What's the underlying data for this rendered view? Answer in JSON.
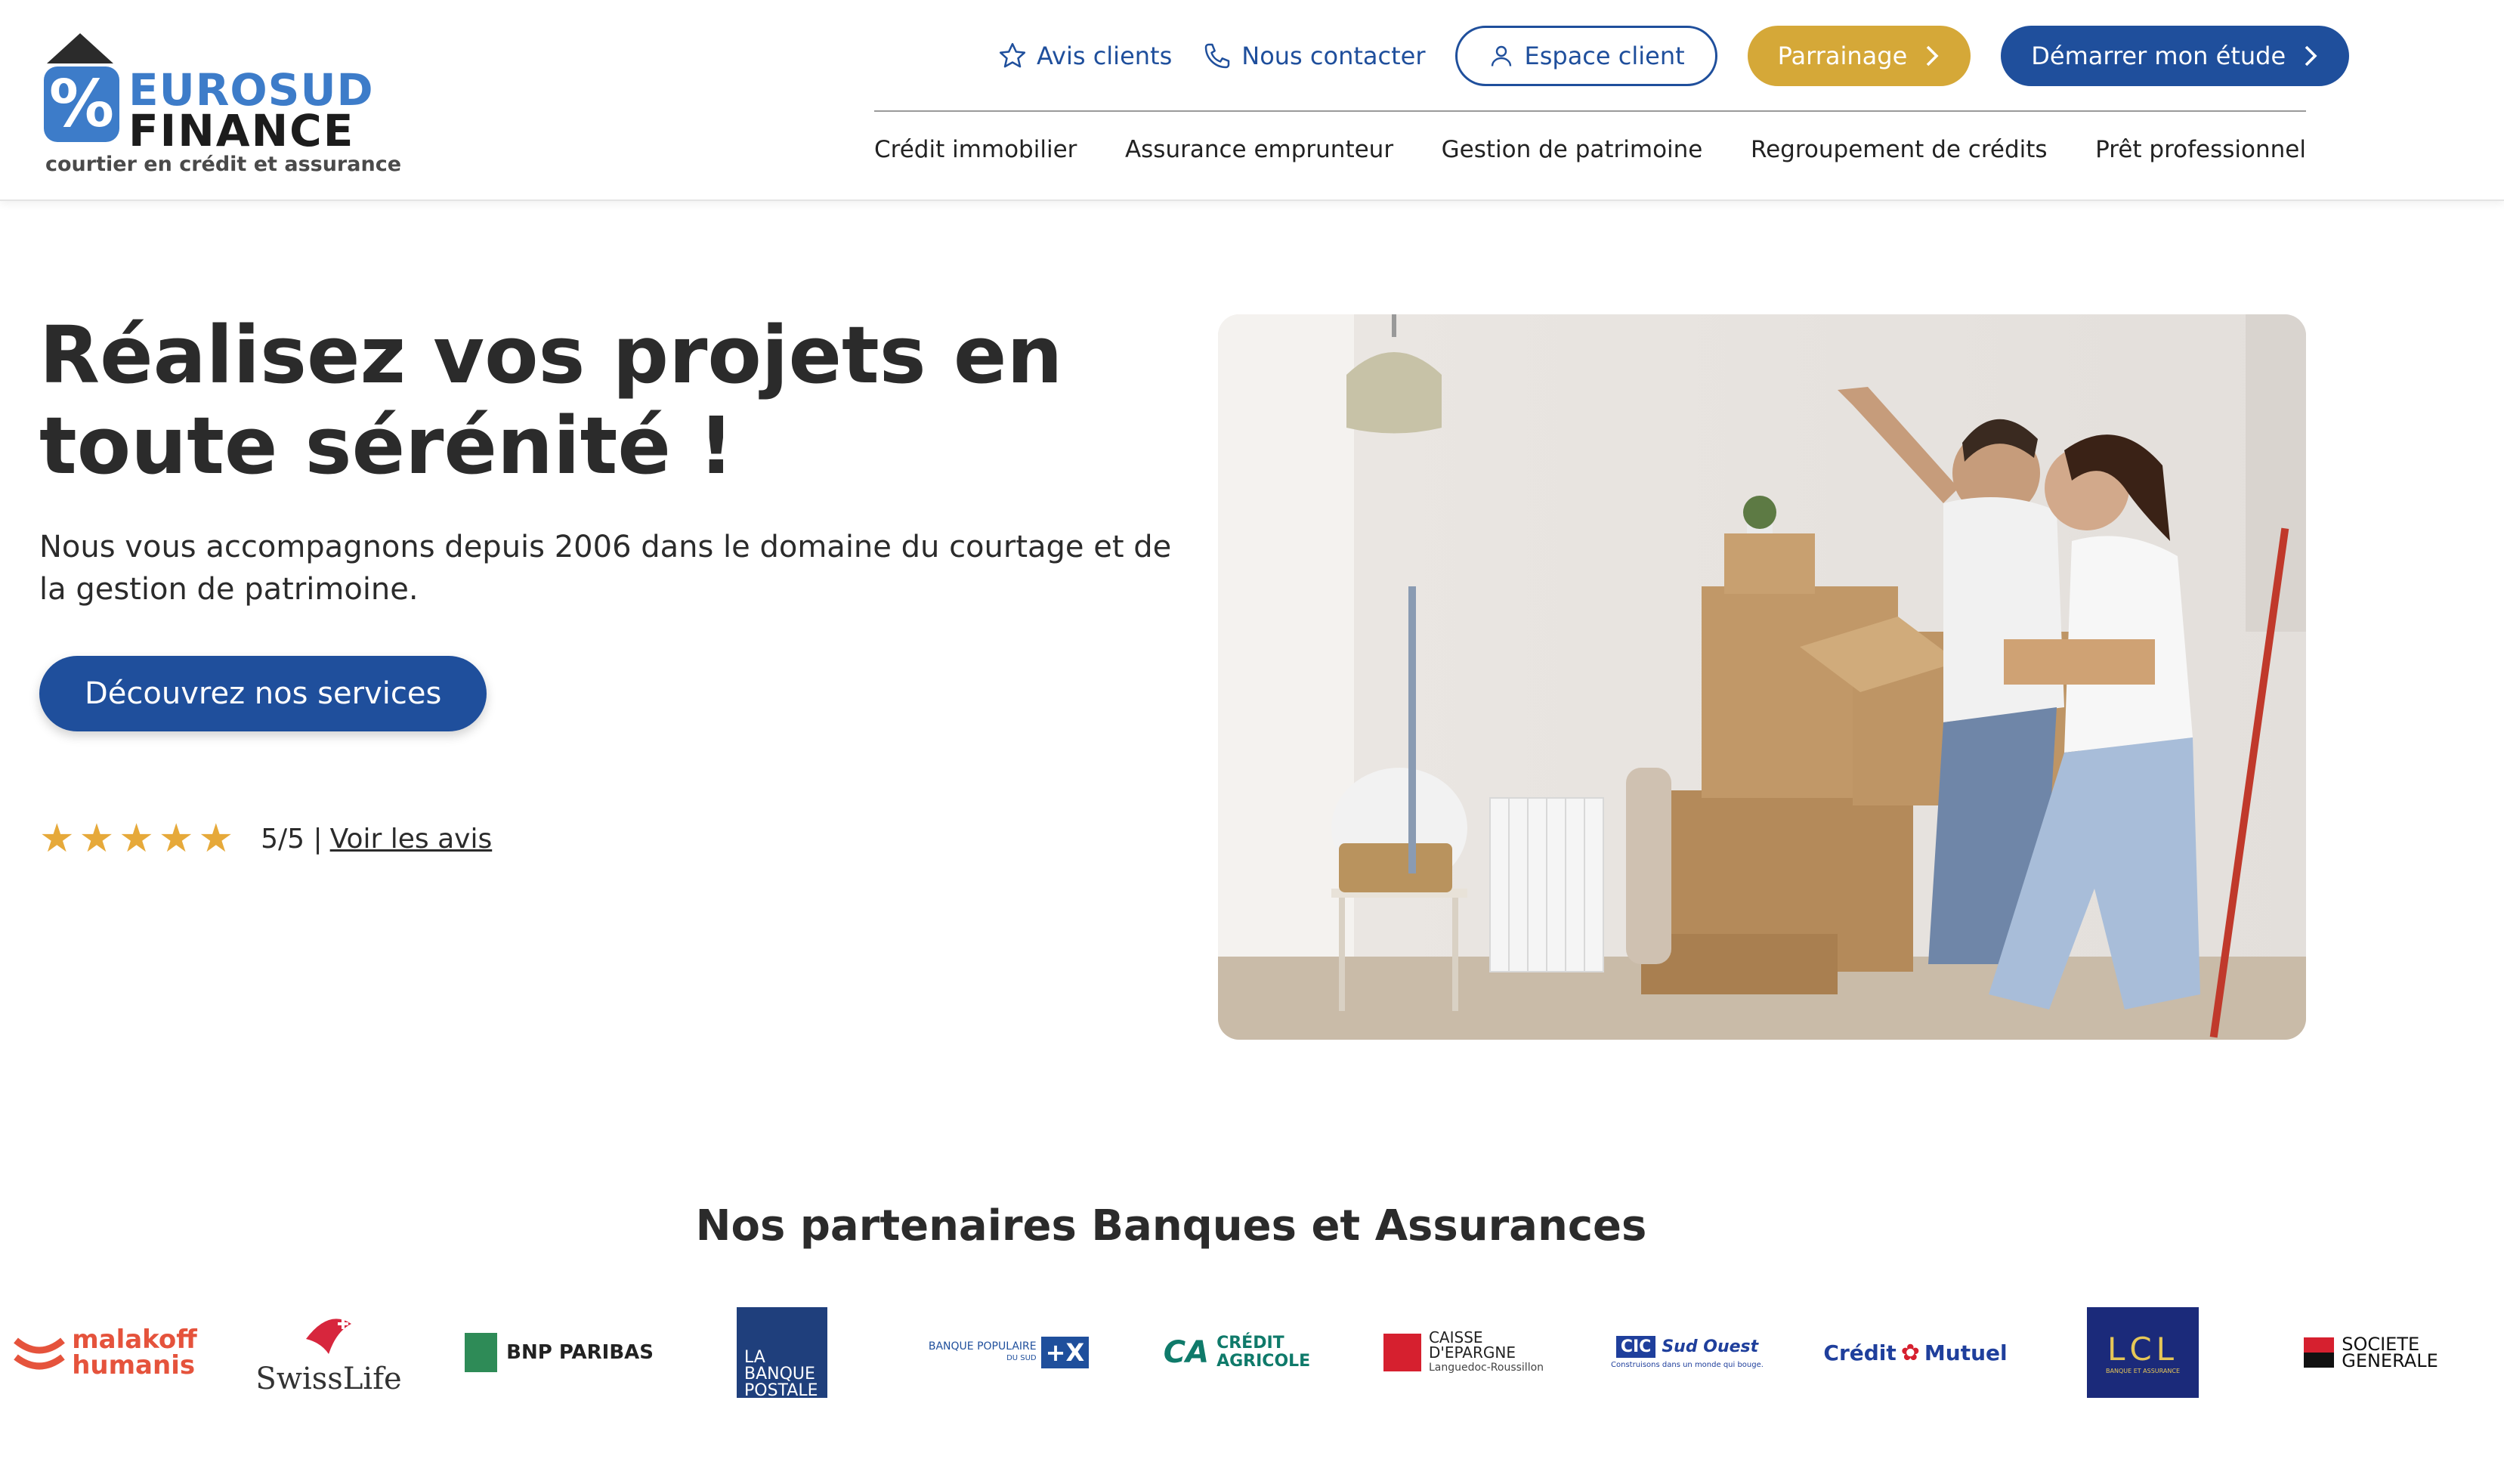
{
  "brand": {
    "word1": "EUROSUD",
    "word2": "FINANCE",
    "tagline": "courtier en crédit et assurance",
    "badge_symbol": "%",
    "colors": {
      "primary_blue": "#1f4f9c",
      "logo_blue": "#3d7cc9",
      "gold": "#d5a838",
      "star": "#e6a93a"
    }
  },
  "header": {
    "top_links": [
      {
        "label": "Avis clients",
        "icon": "star-outline-icon"
      },
      {
        "label": "Nous contacter",
        "icon": "phone-icon"
      }
    ],
    "espace_client": {
      "label": "Espace client",
      "icon": "user-icon"
    },
    "parrainage": {
      "label": "Parrainage",
      "icon": "chevron-right-icon"
    },
    "demarrer": {
      "label": "Démarrer mon étude",
      "icon": "chevron-right-icon"
    },
    "nav": [
      "Crédit immobilier",
      "Assurance emprunteur",
      "Gestion de patrimoine",
      "Regroupement de crédits",
      "Prêt professionnel"
    ]
  },
  "hero": {
    "title": "Réalisez vos projets en toute sérénité !",
    "subtitle": "Nous vous accompagnons depuis 2006 dans le domaine du courtage et de la gestion de patrimoine.",
    "cta": "Découvrez nos services",
    "rating": {
      "stars": 5,
      "text": "5/5 |",
      "link": "Voir les avis"
    }
  },
  "partners": {
    "title": "Nos partenaires Banques et Assurances",
    "logos": [
      {
        "name": "Malakoff Humanis",
        "line1": "malakoff",
        "line2": "humanis"
      },
      {
        "name": "Swiss Life",
        "text": "SwissLife"
      },
      {
        "name": "BNP Paribas",
        "text": "BNP PARIBAS"
      },
      {
        "name": "La Banque Postale",
        "line1": "LA",
        "line2": "BANQUE",
        "line3": "POSTALE"
      },
      {
        "name": "Banque Populaire du Sud",
        "text": "BANQUE POPULAIRE",
        "sub": "DU SUD",
        "mark": "+X"
      },
      {
        "name": "Crédit Agricole",
        "line1": "CRÉDIT",
        "line2": "AGRICOLE",
        "mark": "CA"
      },
      {
        "name": "Caisse d'Epargne",
        "line1": "CAISSE",
        "line2": "D'EPARGNE",
        "line3": "Languedoc-Roussillon"
      },
      {
        "name": "CIC Sud Ouest",
        "mark": "CIC",
        "text": "Sud Ouest",
        "sub": "Construisons dans un monde qui bouge."
      },
      {
        "name": "Crédit Mutuel",
        "line1": "Crédit",
        "line2": "Mutuel"
      },
      {
        "name": "LCL",
        "text": "LCL",
        "sub": "BANQUE ET ASSURANCE"
      },
      {
        "name": "Société Générale",
        "line1": "SOCIETE",
        "line2": "GENERALE"
      }
    ]
  }
}
